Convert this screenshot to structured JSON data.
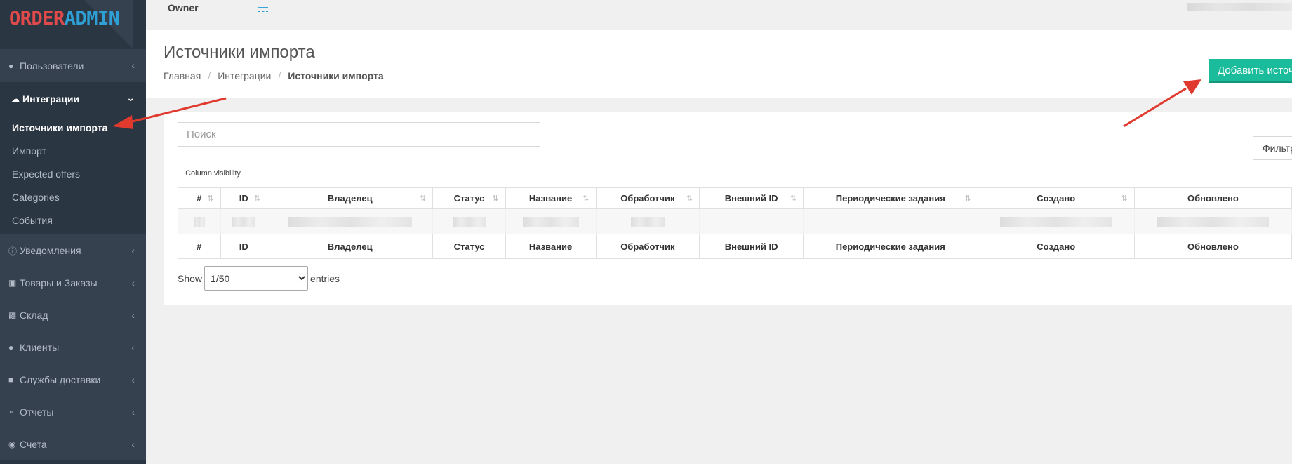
{
  "app": {
    "logo_part1": "ORDER",
    "logo_part2": "ADMIN"
  },
  "topbar": {
    "owner_label": "Owner",
    "owner_value": "—"
  },
  "sidebar": {
    "items": [
      {
        "label": "Пользователи",
        "icon": "user-icon"
      },
      {
        "label": "Интеграции",
        "icon": "cloud-upload-icon"
      },
      {
        "label": "Уведомления",
        "icon": "info-circle-icon"
      },
      {
        "label": "Товары и Заказы",
        "icon": "cart-icon"
      },
      {
        "label": "Склад",
        "icon": "cubes-icon"
      },
      {
        "label": "Клиенты",
        "icon": "users-icon"
      },
      {
        "label": "Службы доставки",
        "icon": "truck-icon"
      },
      {
        "label": "Отчеты",
        "icon": "paperclip-icon"
      },
      {
        "label": "Счета",
        "icon": "piggy-bank-icon"
      }
    ],
    "sub_items": [
      "Источники импорта",
      "Импорт",
      "Expected offers",
      "Categories",
      "События"
    ]
  },
  "page": {
    "title": "Источники импорта",
    "breadcrumb": [
      "Главная",
      "Интеграции",
      "Источники импорта"
    ],
    "add_button": "Добавить источник"
  },
  "toolbar": {
    "search_placeholder": "Поиск",
    "filter_label": "Фильтр",
    "column_visibility": "Column visibility"
  },
  "table": {
    "columns": [
      "#",
      "ID",
      "Владелец",
      "Статус",
      "Название",
      "Обработчик",
      "Внешний ID",
      "Периодические задания",
      "Создано",
      "Обновлено"
    ]
  },
  "pagination": {
    "show_label": "Show",
    "entries_label": "entries",
    "page_size": "1/50"
  },
  "colors": {
    "sidebar": "#2b3643",
    "accent": "#1bbc9b",
    "annotation": "#e03a2f"
  }
}
